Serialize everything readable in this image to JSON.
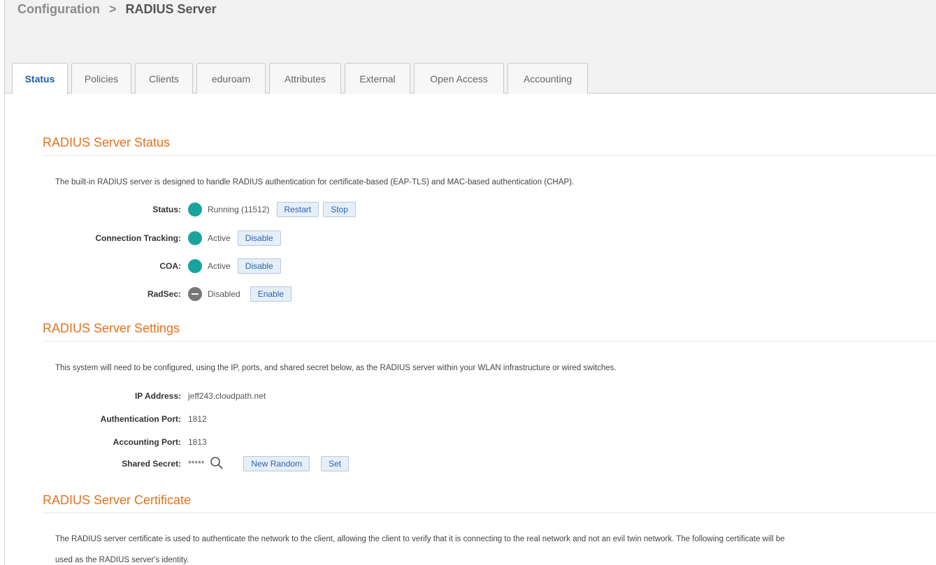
{
  "breadcrumb": {
    "parent": "Configuration",
    "separator": ">",
    "current": "RADIUS Server"
  },
  "tabs": [
    {
      "label": "Status",
      "active": true
    },
    {
      "label": "Policies"
    },
    {
      "label": "Clients"
    },
    {
      "label": "eduroam"
    },
    {
      "label": "Attributes"
    },
    {
      "label": "External"
    },
    {
      "label": "Open Access"
    },
    {
      "label": "Accounting"
    }
  ],
  "status_section": {
    "title": "RADIUS Server Status",
    "description": "The built-in RADIUS server is designed to handle RADIUS authentication for certificate-based (EAP-TLS) and MAC-based authentication (CHAP).",
    "rows": {
      "status": {
        "label": "Status:",
        "value": "Running (11512)",
        "buttons": [
          "Restart",
          "Stop"
        ]
      },
      "connection_tracking": {
        "label": "Connection Tracking:",
        "value": "Active",
        "button": "Disable"
      },
      "coa": {
        "label": "COA:",
        "value": "Active",
        "button": "Disable"
      },
      "radsec": {
        "label": "RadSec:",
        "value": "Disabled",
        "button": "Enable"
      }
    }
  },
  "settings_section": {
    "title": "RADIUS Server Settings",
    "description": "This system will need to be configured, using the IP, ports, and shared secret below, as the RADIUS server within your WLAN infrastructure or wired switches.",
    "rows": {
      "ip": {
        "label": "IP Address:",
        "value": "jeff243.cloudpath.net"
      },
      "auth_port": {
        "label": "Authentication Port:",
        "value": "1812"
      },
      "acct_port": {
        "label": "Accounting Port:",
        "value": "1813"
      },
      "secret": {
        "label": "Shared Secret:",
        "value": "*****",
        "buttons": [
          "New Random",
          "Set"
        ]
      }
    }
  },
  "certificate_section": {
    "title": "RADIUS Server Certificate",
    "description_line1": "The RADIUS server certificate is used to authenticate the network to the client, allowing the client to verify that it is connecting to the real network and not an evil twin network. The following certificate will be",
    "description_line2": "used as the RADIUS server's identity."
  },
  "colors": {
    "accent": "#e8701e",
    "active": "#1aa39d",
    "link": "#2b65b0"
  }
}
